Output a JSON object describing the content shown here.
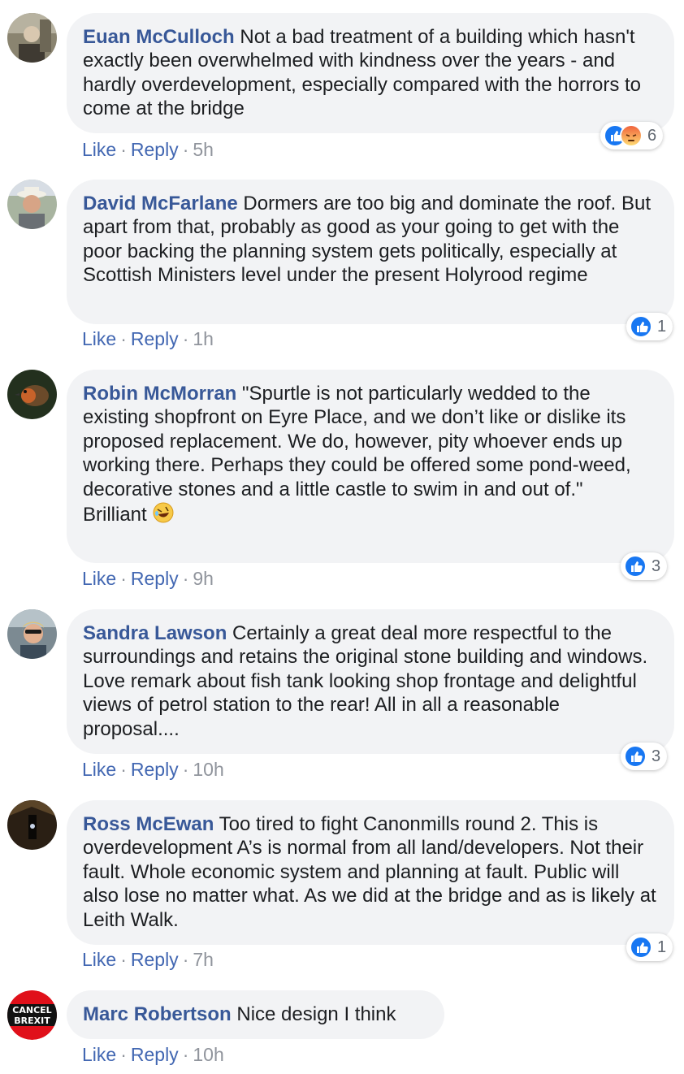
{
  "comments": [
    {
      "author": "Euan McCulloch",
      "text": "Not a bad treatment of a building which hasn't exactly been overwhelmed with kindness over the years - and hardly overdevelopment, especially compared with the horrors to come at the bridge",
      "actions": {
        "like": "Like",
        "reply": "Reply",
        "time": "5h"
      },
      "reactions": {
        "icons": [
          "like-icon",
          "angry-icon"
        ],
        "count": "6"
      }
    },
    {
      "author": "David McFarlane",
      "text": "Dormers are too big and dominate the roof. But apart from that, probably as good as your going to get with the poor backing the planning system gets politically, especially at Scottish Ministers level under the present Holyrood regime",
      "actions": {
        "like": "Like",
        "reply": "Reply",
        "time": "1h"
      },
      "reactions": {
        "icons": [
          "like-icon"
        ],
        "count": "1"
      }
    },
    {
      "author": "Robin McMorran",
      "text": "\"Spurtle is not particularly wedded to the existing shopfront on Eyre Place, and we don’t like or dislike its proposed replacement. We do, however, pity whoever ends up working there. Perhaps they could be offered some pond-weed, decorative stones and a little castle to swim in and out of.\"",
      "text2": "Brilliant",
      "emoji": "rolling-on-floor-laughing-emoji",
      "actions": {
        "like": "Like",
        "reply": "Reply",
        "time": "9h"
      },
      "reactions": {
        "icons": [
          "like-icon"
        ],
        "count": "3"
      }
    },
    {
      "author": "Sandra Lawson",
      "text": "Certainly a great deal more respectful to the surroundings and retains the original stone building and windows. Love remark about fish tank looking shop frontage and delightful views of petrol station to the rear! All in all a reasonable proposal....",
      "actions": {
        "like": "Like",
        "reply": "Reply",
        "time": "10h"
      },
      "reactions": {
        "icons": [
          "like-icon"
        ],
        "count": "3"
      }
    },
    {
      "author": "Ross McEwan",
      "text": "Too tired to fight Canonmills round 2. This is overdevelopment A’s is normal from all land/developers. Not their fault. Whole economic system and planning at fault. Public will also lose no matter what. As we did at the bridge and as is likely at Leith Walk.",
      "actions": {
        "like": "Like",
        "reply": "Reply",
        "time": "7h"
      },
      "reactions": {
        "icons": [
          "like-icon"
        ],
        "count": "1"
      }
    },
    {
      "author": "Marc Robertson",
      "text": "Nice design I think",
      "avatar_text": [
        "CANCEL",
        "BREXIT"
      ],
      "actions": {
        "like": "Like",
        "reply": "Reply",
        "time": "10h"
      }
    }
  ],
  "separator": "·",
  "colors": {
    "author": "#385898",
    "link": "#4267b2",
    "meta": "#90949c",
    "bubble": "#f2f3f5",
    "like_blue": "#1877f2",
    "angry": "#f0633c"
  }
}
